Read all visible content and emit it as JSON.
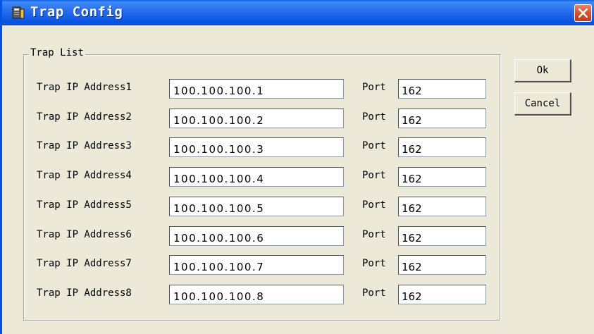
{
  "window": {
    "title": "Trap Config",
    "icons": {
      "app": "app-icon",
      "close": "close-icon"
    }
  },
  "group": {
    "title": "Trap List"
  },
  "port_label": "Port",
  "rows": [
    {
      "label": "Trap IP Address1",
      "ip": "100.100.100.1",
      "port": "162"
    },
    {
      "label": "Trap IP Address2",
      "ip": "100.100.100.2",
      "port": "162"
    },
    {
      "label": "Trap IP Address3",
      "ip": "100.100.100.3",
      "port": "162"
    },
    {
      "label": "Trap IP Address4",
      "ip": "100.100.100.4",
      "port": "162"
    },
    {
      "label": "Trap IP Address5",
      "ip": "100.100.100.5",
      "port": "162"
    },
    {
      "label": "Trap IP Address6",
      "ip": "100.100.100.6",
      "port": "162"
    },
    {
      "label": "Trap IP Address7",
      "ip": "100.100.100.7",
      "port": "162"
    },
    {
      "label": "Trap IP Address8",
      "ip": "100.100.100.8",
      "port": "162"
    }
  ],
  "buttons": {
    "ok": "Ok",
    "cancel": "Cancel"
  },
  "colors": {
    "titlebar": "#0a55e0",
    "dialog_bg": "#ece9d8",
    "close_button": "#d5502c"
  }
}
